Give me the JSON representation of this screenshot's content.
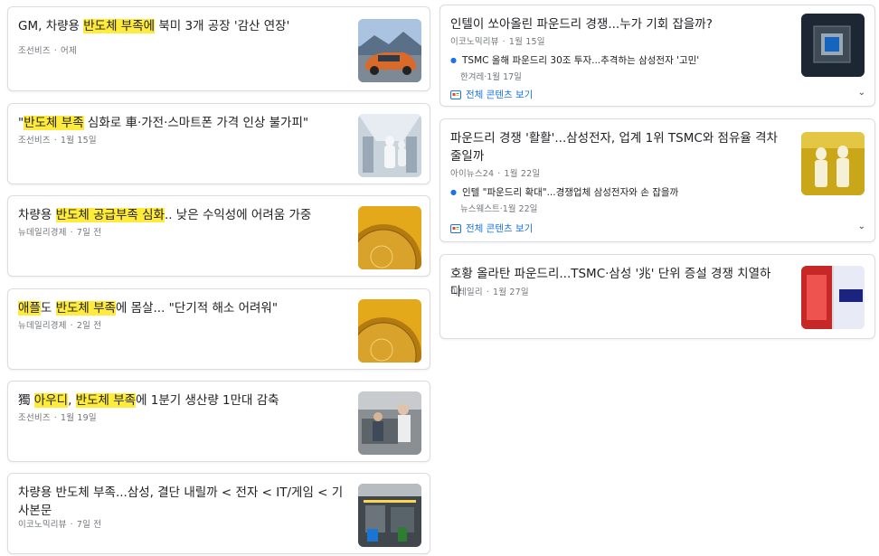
{
  "left_cards": [
    {
      "title_parts": [
        {
          "t": "GM, 차량용 ",
          "hl": false
        },
        {
          "t": "반도체 부족에",
          "hl": true
        },
        {
          "t": " 북미 3개 공장 '감산 연장'",
          "hl": false
        }
      ],
      "source": "조선비즈",
      "time": "어제",
      "thumb": "car-image"
    },
    {
      "title_parts": [
        {
          "t": "\"",
          "hl": false
        },
        {
          "t": "반도체 부족",
          "hl": true
        },
        {
          "t": " 심화로 車·가전·스마트폰 가격 인상 불가피\"",
          "hl": false
        }
      ],
      "source": "조선비즈",
      "time": "1월 15일",
      "thumb": "cleanroom-image"
    },
    {
      "title_parts": [
        {
          "t": "차량용 ",
          "hl": false
        },
        {
          "t": "반도체 공급부족 심화",
          "hl": true
        },
        {
          "t": ".. 낮은 수익성에 어려움 가중",
          "hl": false
        }
      ],
      "source": "뉴데일리경제",
      "time": "7일 전",
      "thumb": "wafer-image"
    },
    {
      "title_parts": [
        {
          "t": "애플",
          "hl": true
        },
        {
          "t": "도 ",
          "hl": false
        },
        {
          "t": "반도체 부족",
          "hl": true
        },
        {
          "t": "에 몸살... \"단기적 해소 어려워\"",
          "hl": false
        }
      ],
      "source": "뉴데일리경제",
      "time": "2일 전",
      "thumb": "wafer-image"
    },
    {
      "title_parts": [
        {
          "t": "獨 ",
          "hl": false
        },
        {
          "t": "아우디",
          "hl": true
        },
        {
          "t": ", ",
          "hl": false
        },
        {
          "t": "반도체 부족",
          "hl": true
        },
        {
          "t": "에 1분기 생산량 1만대 감축",
          "hl": false
        }
      ],
      "source": "조선비즈",
      "time": "1월 19일",
      "thumb": "factory-image"
    },
    {
      "title_parts": [
        {
          "t": "차량용 반도체 부족...삼성, 결단 내릴까 < 전자 < IT/게임 < 기사본문",
          "hl": false
        }
      ],
      "source": "이코노믹리뷰",
      "time": "7일 전",
      "thumb": "assembly-image"
    }
  ],
  "right_cards": [
    {
      "title": "인텔이 쏘아올린 파운드리 경쟁...누가 기회 잡을까?",
      "source": "이코노믹리뷰",
      "time": "1월 15일",
      "sub_title": "TSMC 올해 파운드리 30조 투자...추격하는 삼성전자 '고민'",
      "sub_source": "한겨레",
      "sub_time": "1월 17일",
      "full_label": "전체 콘텐츠 보기",
      "thumb": "chip-image"
    },
    {
      "title": "파운드리 경쟁 '활활'...삼성전자, 업계 1위 TSMC와 점유율 격차 줄일까",
      "source": "아이뉴스24",
      "time": "1월 22일",
      "sub_title": "인텔 \"파운드리 확대\"...경쟁업체 삼성전자와 손 잡을까",
      "sub_source": "뉴스웨스트",
      "sub_time": "1월 22일",
      "full_label": "전체 콘텐츠 보기",
      "thumb": "workers-image"
    },
    {
      "title": "호황 올라탄 파운드리...TSMC·삼성 '兆' 단위 증설 경쟁 치열하다",
      "source": "이데일리",
      "time": "1월 27일",
      "thumb": "logos-image"
    }
  ],
  "colors": {
    "highlight": "#ffeb3b",
    "link": "#1a73e8",
    "meta": "#70757a"
  }
}
